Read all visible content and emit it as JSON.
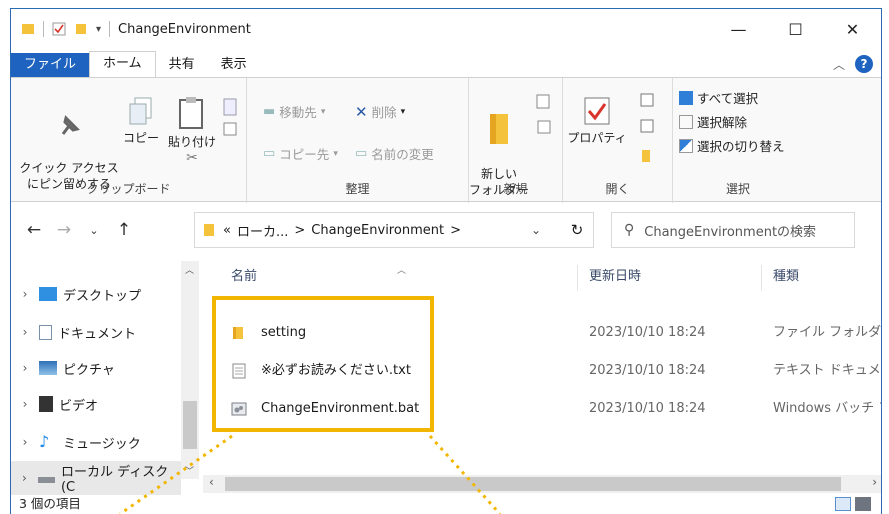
{
  "window": {
    "title": "ChangeEnvironment"
  },
  "tabs": {
    "file": "ファイル",
    "home": "ホーム",
    "share": "共有",
    "view": "表示"
  },
  "ribbon": {
    "clipboard": {
      "pin": "クイック アクセス\nにピン留めする",
      "copy": "コピー",
      "paste": "貼り付け",
      "label": "クリップボード"
    },
    "organize": {
      "move_to": "移動先",
      "delete": "削除",
      "copy_to": "コピー先",
      "rename": "名前の変更",
      "label": "整理"
    },
    "new": {
      "new_folder": "新しい\nフォルダー",
      "label": "新規"
    },
    "open": {
      "properties": "プロパティ",
      "label": "開く"
    },
    "select": {
      "select_all": "すべて選択",
      "select_none": "選択解除",
      "invert": "選択の切り替え",
      "label": "選択"
    }
  },
  "address": {
    "overflow": "«",
    "crumb1": "ローカ...",
    "crumb2": "ChangeEnvironment",
    "sep": ">",
    "search_placeholder": "ChangeEnvironmentの検索"
  },
  "nav": {
    "items": [
      {
        "label": "デスクトップ"
      },
      {
        "label": "ドキュメント"
      },
      {
        "label": "ピクチャ"
      },
      {
        "label": "ビデオ"
      },
      {
        "label": "ミュージック"
      },
      {
        "label": "ローカル ディスク (C"
      }
    ]
  },
  "columns": {
    "name": "名前",
    "date": "更新日時",
    "type": "種類"
  },
  "files": [
    {
      "name": "setting",
      "date": "2023/10/10 18:24",
      "type": "ファイル フォルダー",
      "icon": "folder-icon"
    },
    {
      "name": "※必ずお読みください.txt",
      "date": "2023/10/10 18:24",
      "type": "テキスト ドキュメント",
      "icon": "text-file-icon"
    },
    {
      "name": "ChangeEnvironment.bat",
      "date": "2023/10/10 18:24",
      "type": "Windows バッチ ファイル",
      "icon": "batch-file-icon"
    }
  ],
  "status": {
    "count": "3 個の項目"
  },
  "colors": {
    "accent": "#1e63bf",
    "highlight": "#f2b600",
    "folder": "#f5c33b"
  }
}
